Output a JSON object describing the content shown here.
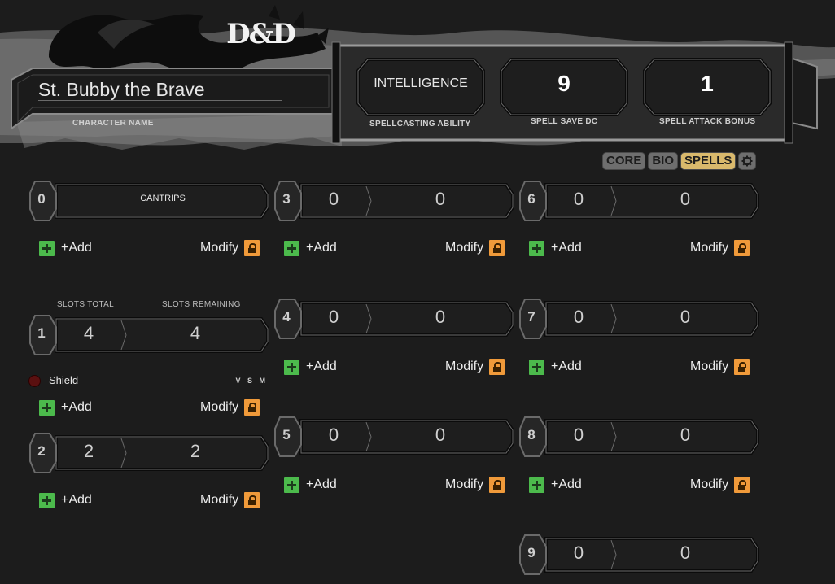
{
  "logo": {
    "text": "D&D"
  },
  "character": {
    "name": "St. Bubby the Brave",
    "name_label": "CHARACTER NAME"
  },
  "stats": {
    "ability": {
      "value": "INTELLIGENCE",
      "label": "SPELLCASTING ABILITY"
    },
    "save_dc": {
      "value": "9",
      "label": "SPELL SAVE DC"
    },
    "attack_bonus": {
      "value": "1",
      "label": "SPELL ATTACK BONUS"
    }
  },
  "tabs": [
    {
      "label": "CORE",
      "active": false
    },
    {
      "label": "BIO",
      "active": false
    },
    {
      "label": "SPELLS",
      "active": true
    }
  ],
  "actions": {
    "add_label": "+Add",
    "modify_label": "Modify"
  },
  "slot_headers": {
    "total": "SLOTS TOTAL",
    "remaining": "SLOTS REMAINING"
  },
  "levels": [
    {
      "level": "0",
      "title": "CANTRIPS"
    },
    {
      "level": "1",
      "total": "4",
      "remaining": "4"
    },
    {
      "level": "2",
      "total": "2",
      "remaining": "2"
    },
    {
      "level": "3",
      "total": "0",
      "remaining": "0"
    },
    {
      "level": "4",
      "total": "0",
      "remaining": "0"
    },
    {
      "level": "5",
      "total": "0",
      "remaining": "0"
    },
    {
      "level": "6",
      "total": "0",
      "remaining": "0"
    },
    {
      "level": "7",
      "total": "0",
      "remaining": "0"
    },
    {
      "level": "8",
      "total": "0",
      "remaining": "0"
    },
    {
      "level": "9",
      "total": "0",
      "remaining": "0"
    }
  ],
  "spells": [
    {
      "level": "1",
      "name": "Shield",
      "components": "V S M"
    }
  ],
  "colors": {
    "accent": "#d9b96c",
    "add": "#4cba4c",
    "lock": "#f09a3a",
    "background": "#1c1c1c"
  }
}
